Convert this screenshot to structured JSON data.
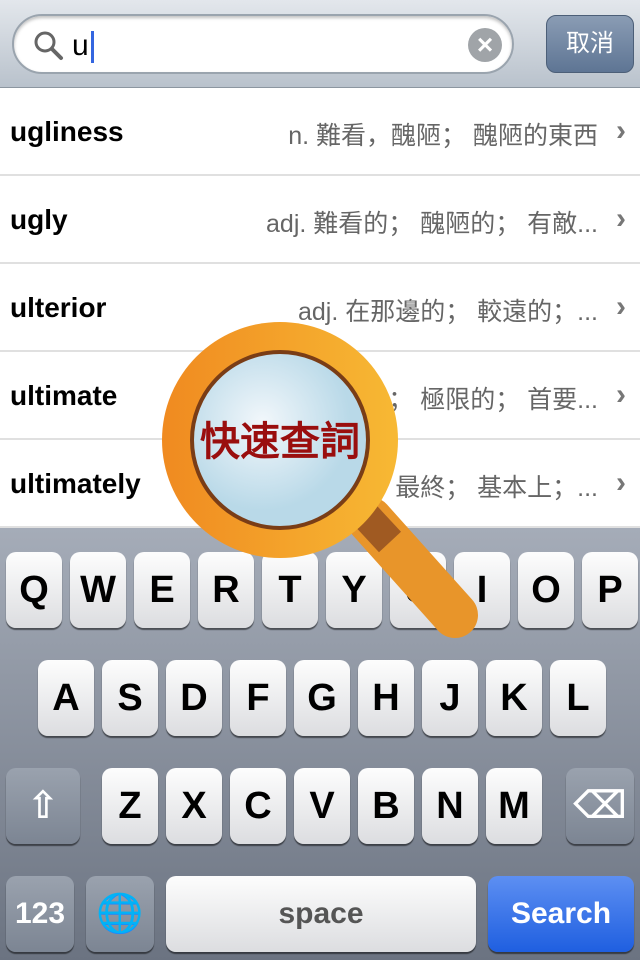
{
  "search": {
    "value": "u",
    "cancel_label": "取消"
  },
  "results": [
    {
      "word": "ugliness",
      "definition": "n. 難看，醜陋； 醜陋的東西"
    },
    {
      "word": "ugly",
      "definition": "adj. 難看的； 醜陋的； 有敵..."
    },
    {
      "word": "ulterior",
      "definition": "adj. 在那邊的； 較遠的；..."
    },
    {
      "word": "ultimate",
      "definition": "； 極限的； 首要..."
    },
    {
      "word": "ultimately",
      "definition": "最終； 基本上；..."
    }
  ],
  "overlay": {
    "label": "快速查詞"
  },
  "keyboard": {
    "row1": [
      "Q",
      "W",
      "E",
      "R",
      "T",
      "Y",
      "U",
      "I",
      "O",
      "P"
    ],
    "row2": [
      "A",
      "S",
      "D",
      "F",
      "G",
      "H",
      "J",
      "K",
      "L"
    ],
    "row3": [
      "Z",
      "X",
      "C",
      "V",
      "B",
      "N",
      "M"
    ],
    "numbers": "123",
    "space": "space",
    "search": "Search"
  }
}
